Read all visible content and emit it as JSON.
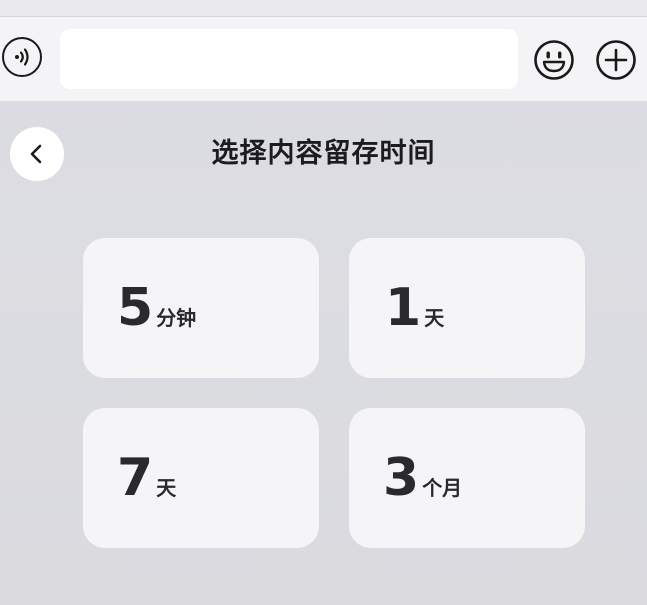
{
  "input_bar": {
    "voice_icon": "voice-icon",
    "input_value": "",
    "emoji_icon": "emoji-icon",
    "plus_icon": "plus-icon"
  },
  "header": {
    "back_icon": "chevron-left-icon",
    "title": "选择内容留存时间"
  },
  "options": [
    {
      "number": "5",
      "unit": "分钟"
    },
    {
      "number": "1",
      "unit": "天"
    },
    {
      "number": "7",
      "unit": "天"
    },
    {
      "number": "3",
      "unit": "个月"
    }
  ],
  "colors": {
    "background": "#dcdde2",
    "card": "#f5f5f7",
    "text": "#2a2a2c"
  }
}
